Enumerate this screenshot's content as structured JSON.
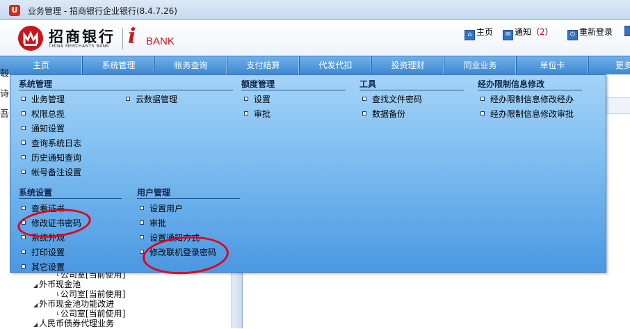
{
  "window": {
    "title": "业务管理 - 招商银行企业银行(8.4.7.26)"
  },
  "brand": {
    "cn": "招商银行",
    "en": "CHINA MERCHANTS BANK",
    "ibank_i": "i",
    "ibank_word": "BANK"
  },
  "toplinks": {
    "home": "主页",
    "notice": "通知",
    "notice_open": "（",
    "notice_count": "2",
    "notice_close": "）",
    "relogin": "重新登录"
  },
  "nav": [
    "主页",
    "系统管理",
    "帐务查询",
    "支付结算",
    "代发代扣",
    "投资理财",
    "同业业务",
    "单位卡",
    "更多"
  ],
  "menu": {
    "sys_mgmt": {
      "title": "系统管理",
      "col1": [
        "业务管理",
        "权限总揽",
        "通知设置",
        "查询系统日志",
        "历史通知查询",
        "帐号备注设置"
      ],
      "col2": [
        "云数据管理"
      ]
    },
    "quota": {
      "title": "额度管理",
      "items": [
        "设置",
        "审批"
      ]
    },
    "tools": {
      "title": "工具",
      "items": [
        "查找文件密码",
        "数据备份"
      ]
    },
    "limit": {
      "title": "经办限制信息修改",
      "items": [
        "经办限制信息修改经办",
        "经办限制信息修改审批"
      ]
    },
    "sys_settings": {
      "title": "系统设置",
      "items": [
        "查看证书",
        "修改证书密码",
        "系统外观",
        "打印设置",
        "其它设置"
      ]
    },
    "user_mgmt": {
      "title": "用户管理",
      "items": [
        "设置用户",
        "审批",
        "设置通知方式",
        "修改联机登录密码"
      ]
    }
  },
  "background": {
    "cut_lines": [
      "彀",
      "诗",
      "吾"
    ],
    "tree": [
      {
        "text": "公司室[当前使用]",
        "indent": 2
      },
      {
        "text": "外币现金池",
        "indent": 1
      },
      {
        "text": "公司室[当前使用]",
        "indent": 2
      },
      {
        "text": "外币现金池功能改进",
        "indent": 1
      },
      {
        "text": "公司室[当前使用]",
        "indent": 2
      },
      {
        "text": "人民币债券代理业务",
        "indent": 1
      }
    ]
  },
  "colors": {
    "accent_red": "#c8161d",
    "nav_blue": "#3c86d0",
    "annotation": "#e2001a"
  }
}
